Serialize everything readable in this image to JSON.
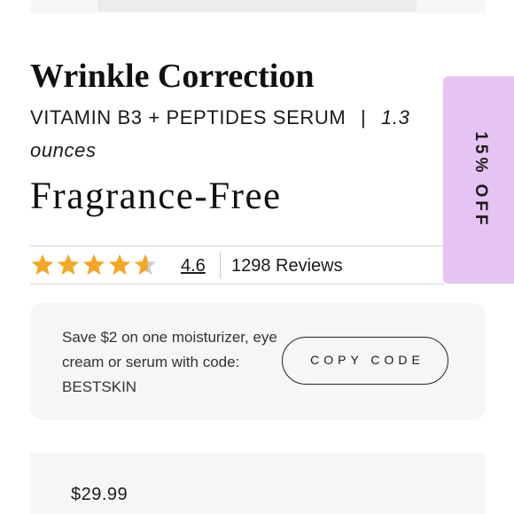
{
  "product": {
    "title": "Wrinkle Correction",
    "subtitle": "VITAMIN B3 + PEPTIDES SERUM",
    "separator": "|",
    "size": "1.3 ounces",
    "variant": "Fragrance-Free"
  },
  "rating": {
    "value": "4.6",
    "stars": 4.6,
    "reviews_label": "1298 Reviews",
    "star_color": "#f5a623",
    "star_empty_color": "#cfcfcf"
  },
  "discount_tab": {
    "label": "15% OFF",
    "color": "#e5c3f2"
  },
  "promo": {
    "text": "Save $2 on one moisturizer, eye cream or serum with code: BESTSKIN",
    "button_label": "COPY CODE"
  },
  "price": {
    "value": "$29.99"
  }
}
